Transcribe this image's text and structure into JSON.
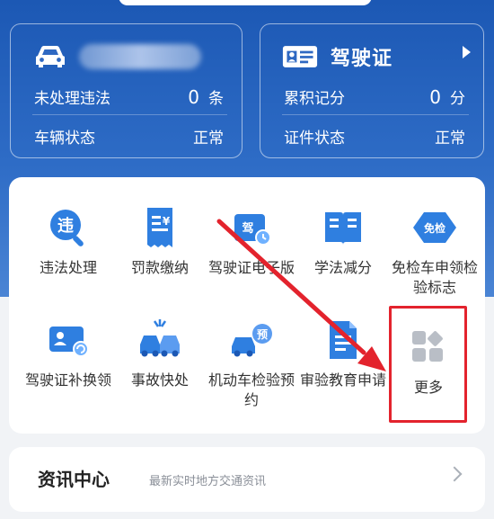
{
  "vehicle_card": {
    "violations_label": "未处理违法",
    "violations_value": "0",
    "violations_unit": "条",
    "status_label": "车辆状态",
    "status_value": "正常"
  },
  "license_card": {
    "title": "驾驶证",
    "points_label": "累积记分",
    "points_value": "0",
    "points_unit": "分",
    "status_label": "证件状态",
    "status_value": "正常"
  },
  "services": [
    {
      "label": "违法处理",
      "icon": "violation-icon"
    },
    {
      "label": "罚款缴纳",
      "icon": "receipt-icon"
    },
    {
      "label": "驾驶证电子版",
      "icon": "e-license-icon"
    },
    {
      "label": "学法减分",
      "icon": "book-icon"
    },
    {
      "label": "免检车申领检验标志",
      "icon": "exempt-badge-icon"
    },
    {
      "label": "驾驶证补换领",
      "icon": "license-replace-icon"
    },
    {
      "label": "事故快处",
      "icon": "accident-icon"
    },
    {
      "label": "机动车检验预约",
      "icon": "inspection-booking-icon"
    },
    {
      "label": "审验教育申请",
      "icon": "education-doc-icon"
    },
    {
      "label": "更多",
      "icon": "more-grid-icon"
    }
  ],
  "news": {
    "title": "资讯中心",
    "subtitle": "最新实时地方交通资讯"
  },
  "colors": {
    "brand_blue": "#1c58b4",
    "icon_blue": "#2f7fe0",
    "highlight_red": "#e3232d"
  }
}
